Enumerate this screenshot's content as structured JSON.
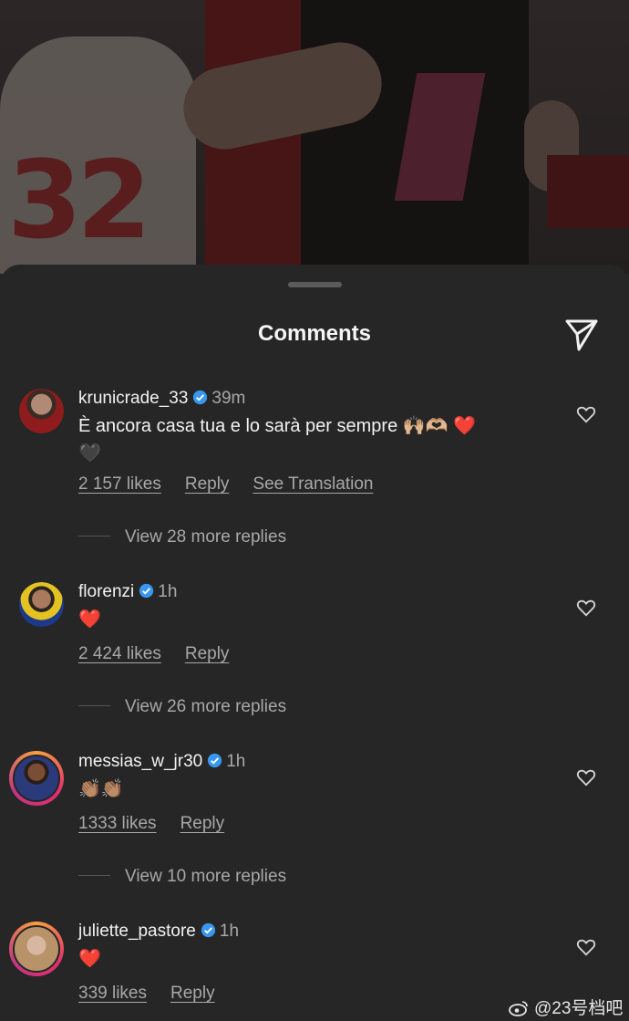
{
  "sheet": {
    "title": "Comments"
  },
  "comments": [
    {
      "username": "krunicrade_33",
      "time": "39m",
      "text": "È ancora casa tua e lo sarà per sempre 🙌🫶❤️🖤",
      "text_line1": "È ancora casa tua e lo sarà per sempre 🙌🏼🫶🏼 ❤️",
      "text_line2": "🖤",
      "likes": "2 157 likes",
      "reply": "Reply",
      "translate": "See Translation",
      "view_replies": "View 28 more replies"
    },
    {
      "username": "florenzi",
      "time": "1h",
      "text": "❤️",
      "likes": "2 424 likes",
      "reply": "Reply",
      "view_replies": "View 26 more replies"
    },
    {
      "username": "messias_w_jr30",
      "time": "1h",
      "text": "👏🏽👏🏽",
      "likes": "1333 likes",
      "reply": "Reply",
      "view_replies": "View 10 more replies"
    },
    {
      "username": "juliette_pastore",
      "time": "1h",
      "text": "❤️",
      "likes": "339 likes",
      "reply": "Reply"
    }
  ],
  "watermark": "@23号档吧",
  "colors": {
    "sheet_bg": "#262626",
    "verified": "#3897f0",
    "secondary_text": "#a8a8a8",
    "heart": "#e0242f"
  },
  "icons": {
    "share": "paper-plane-icon",
    "like": "heart-outline-icon",
    "verified": "verified-badge-icon"
  }
}
